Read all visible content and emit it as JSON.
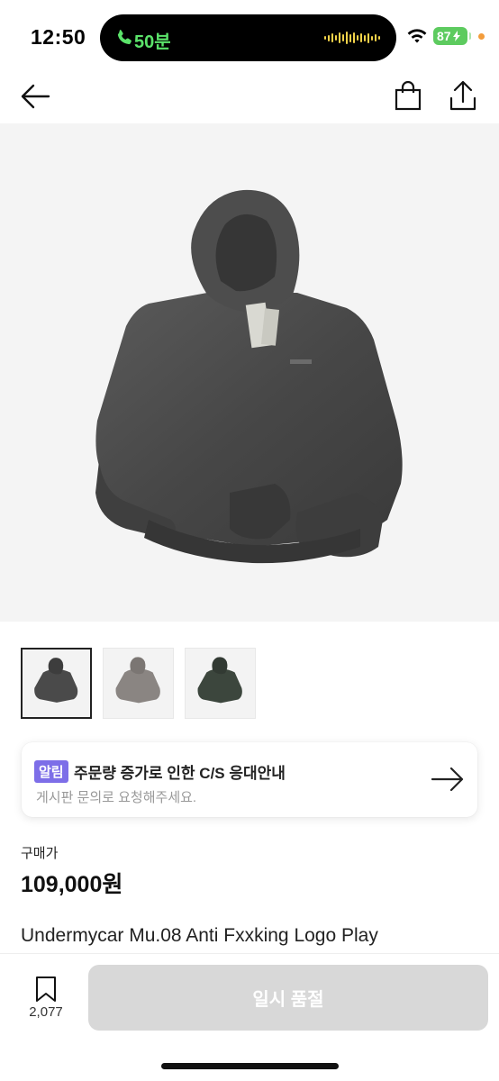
{
  "status_bar": {
    "time": "12:50",
    "call_duration": "50분",
    "battery": "87"
  },
  "header": {
    "back_icon": "arrow-left-icon",
    "bag_icon": "shopping-bag-icon",
    "share_icon": "share-icon"
  },
  "gallery": {
    "main_alt": "charcoal washed hoodie",
    "thumbnails": [
      "charcoal",
      "gray",
      "dark-green"
    ],
    "selected_index": 0
  },
  "notice": {
    "badge": "알림",
    "title": "주문량 증가로 인한 C/S 응대안내",
    "subtitle": "게시판 문의로 요청해주세요."
  },
  "price": {
    "label": "구매가",
    "value": "109,000원"
  },
  "product": {
    "title": "Undermycar Mu.08 Anti Fxxking Logo Play"
  },
  "bottom_bar": {
    "wish_count": "2,077",
    "soldout_label": "일시 품절"
  },
  "colors": {
    "accent_badge": "#7d6ee8",
    "call_green": "#5be36a",
    "battery_green": "#5dcb5f",
    "disabled_button": "#d8d8d8"
  }
}
